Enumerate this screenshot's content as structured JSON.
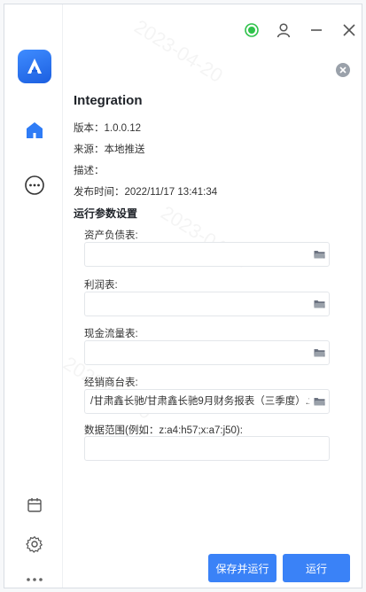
{
  "app": {
    "title": "Integration"
  },
  "titlebar": {
    "icons": [
      "status-dot-icon",
      "user-icon",
      "minimize-icon",
      "close-icon"
    ],
    "status_color": "#2ec24a"
  },
  "sidebar": {
    "items": [
      {
        "name": "home",
        "icon": "home-icon"
      },
      {
        "name": "chat",
        "icon": "chat-icon"
      },
      {
        "name": "calendar",
        "icon": "calendar-icon"
      },
      {
        "name": "settings",
        "icon": "gear-icon"
      },
      {
        "name": "more",
        "icon": "more-icon"
      }
    ]
  },
  "info": {
    "version": "版本：1.0.0.12",
    "source": "来源：本地推送",
    "description": "描述：",
    "published": "发布时间：2022/11/17 13:41:34"
  },
  "params": {
    "heading": "运行参数设置",
    "fields": [
      {
        "label": "资产负债表:",
        "value": ""
      },
      {
        "label": "利润表:",
        "value": ""
      },
      {
        "label": "现金流量表:",
        "value": ""
      },
      {
        "label": "经销商台表:",
        "value": "/甘肃鑫长驰/甘肃鑫长驰9月财务报表（三季度）.xls"
      }
    ],
    "range_label": "数据范围(例如：z:a4:h57;x:a7:j50):",
    "range_value": ""
  },
  "actions": {
    "save_run": "保存并运行",
    "run": "运行"
  },
  "colors": {
    "accent": "#3a82f7"
  }
}
